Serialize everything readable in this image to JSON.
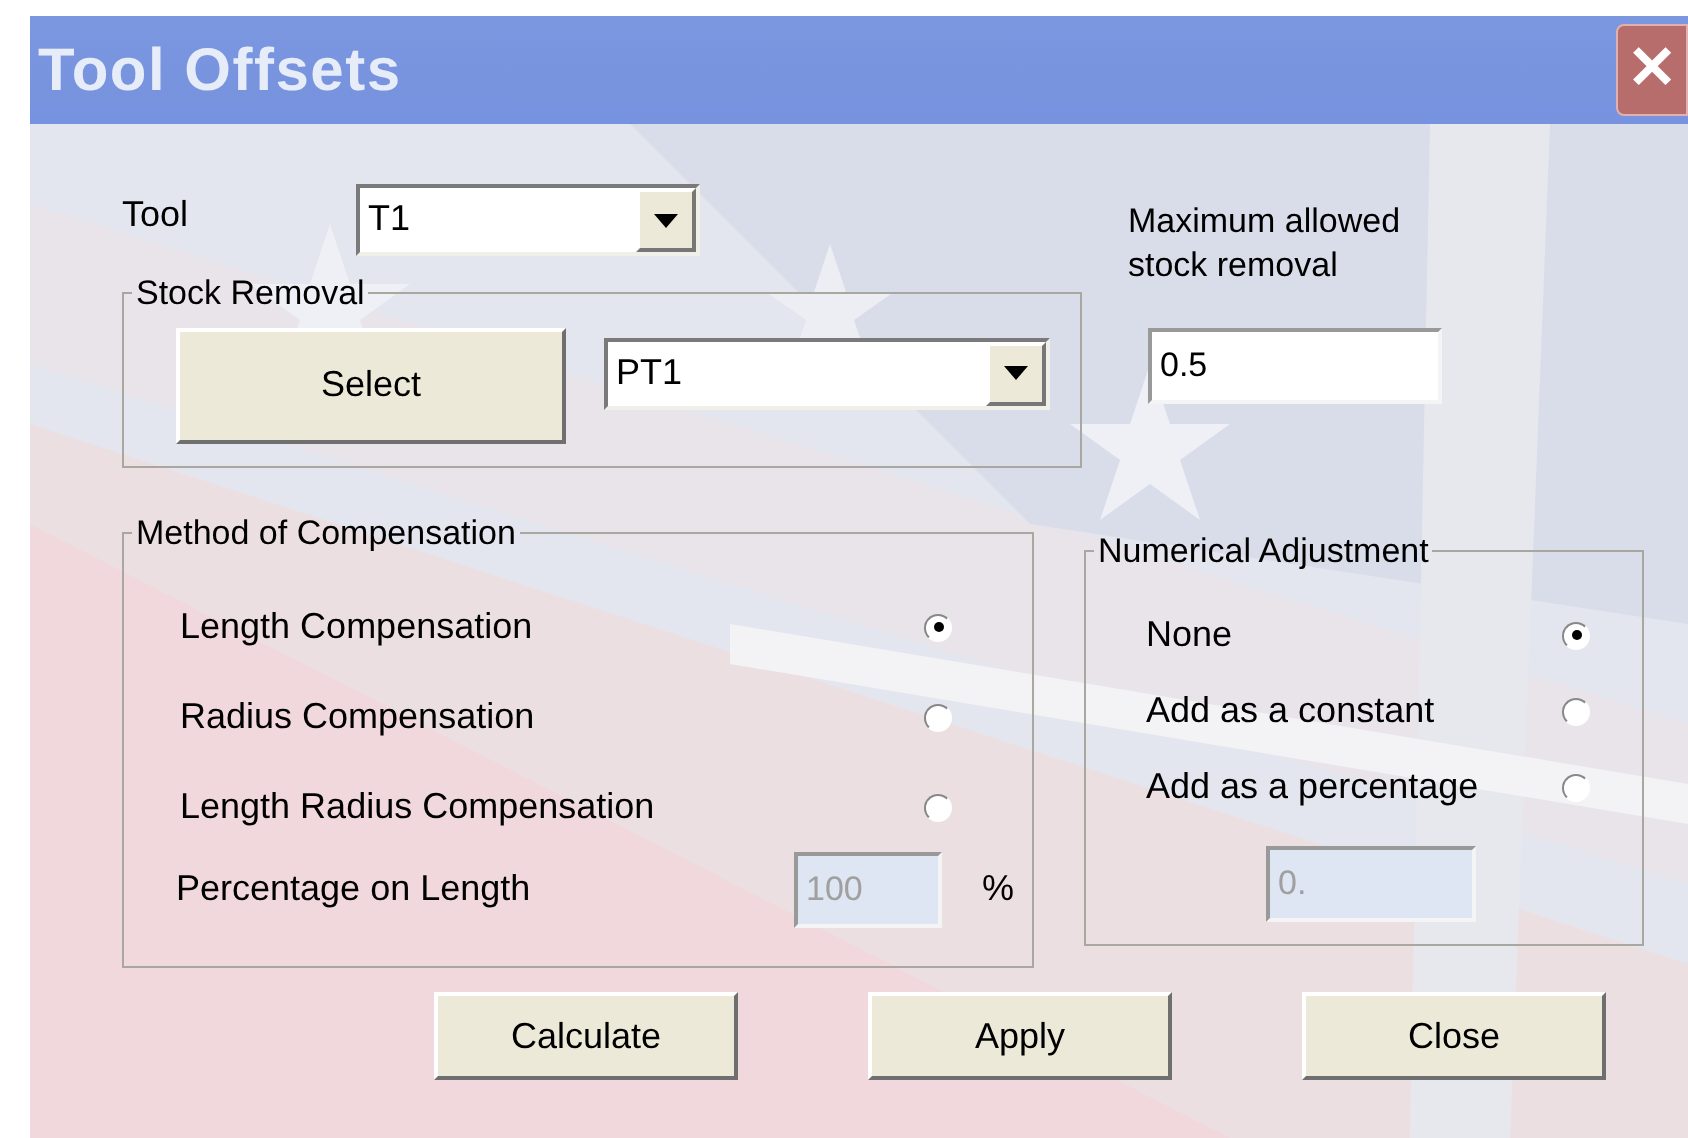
{
  "window": {
    "title": "Tool Offsets",
    "close_glyph": "✕"
  },
  "tool": {
    "label": "Tool",
    "value": "T1"
  },
  "max_removal": {
    "label": "Maximum allowed stock removal",
    "value": "0.5"
  },
  "stock_removal": {
    "title": "Stock Removal",
    "button": "Select",
    "value": "PT1"
  },
  "compensation": {
    "title": "Method of Compensation",
    "options": [
      {
        "label": "Length Compensation",
        "selected": true
      },
      {
        "label": "Radius Compensation",
        "selected": false
      },
      {
        "label": "Length  Radius Compensation",
        "selected": false
      }
    ],
    "percentage": {
      "label": "Percentage on Length",
      "value": "100",
      "unit": "%",
      "disabled": true
    }
  },
  "numerical": {
    "title": "Numerical Adjustment",
    "options": [
      {
        "label": "None",
        "selected": true
      },
      {
        "label": "Add as a constant",
        "selected": false
      },
      {
        "label": "Add as a percentage",
        "selected": false
      }
    ],
    "value": {
      "value": "0.",
      "disabled": true
    }
  },
  "buttons": [
    "Calculate",
    "Apply",
    "Close"
  ]
}
